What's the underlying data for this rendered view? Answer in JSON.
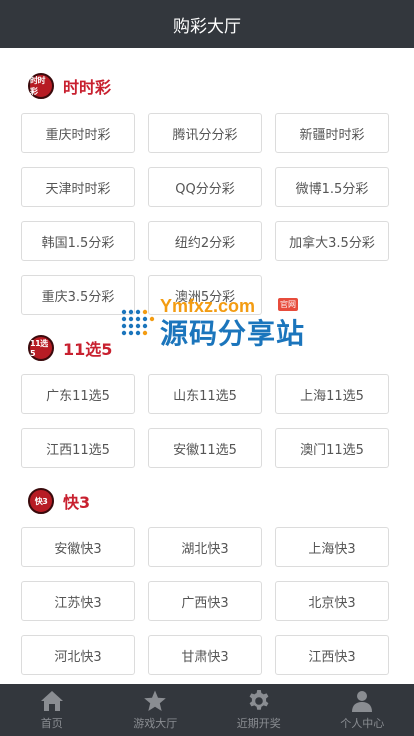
{
  "header": {
    "title": "购彩大厅"
  },
  "sections": [
    {
      "title": "时时彩",
      "icon": "ssc-logo-icon",
      "icon_text": "时时彩",
      "games": [
        "重庆时时彩",
        "腾讯分分彩",
        "新疆时时彩",
        "天津时时彩",
        "QQ分分彩",
        "微博1.5分彩",
        "韩国1.5分彩",
        "纽约2分彩",
        "加拿大3.5分彩",
        "重庆3.5分彩",
        "澳洲5分彩"
      ]
    },
    {
      "title": "11选5",
      "icon": "11x5-logo-icon",
      "icon_text": "11选5",
      "games": [
        "广东11选5",
        "山东11选5",
        "上海11选5",
        "江西11选5",
        "安徽11选5",
        "澳门11选5"
      ]
    },
    {
      "title": "快3",
      "icon": "k3-logo-icon",
      "icon_text": "快3",
      "games": [
        "安徽快3",
        "湖北快3",
        "上海快3",
        "江苏快3",
        "广西快3",
        "北京快3",
        "河北快3",
        "甘肃快3",
        "江西快3"
      ]
    }
  ],
  "watermark": {
    "domain": "Ymfxz.com",
    "badge": "官网",
    "name": "源码分享站"
  },
  "tabbar": [
    {
      "label": "首页",
      "icon": "home-icon"
    },
    {
      "label": "游戏大厅",
      "icon": "star-icon"
    },
    {
      "label": "近期开奖",
      "icon": "gear-icon"
    },
    {
      "label": "个人中心",
      "icon": "user-icon"
    }
  ],
  "colors": {
    "header_bg": "#33373d",
    "accent": "#c8202f",
    "tab_text": "#8a8d92"
  }
}
